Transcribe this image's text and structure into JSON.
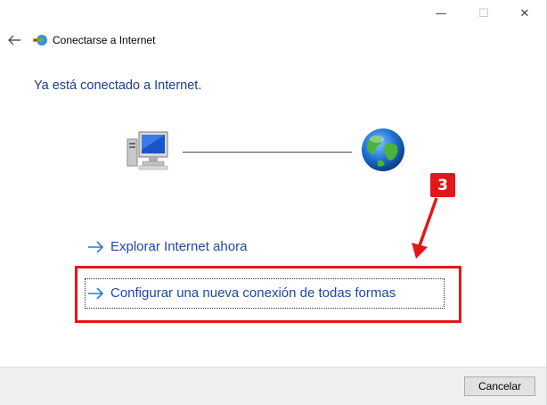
{
  "window": {
    "title": "Conectarse a Internet",
    "caption_buttons": {
      "minimize": "—",
      "maximize": "☐",
      "close": "✕"
    }
  },
  "main": {
    "heading": "Ya está conectado a Internet.",
    "links": [
      {
        "label": "Explorar Internet ahora"
      },
      {
        "label": "Configurar una nueva conexión de todas formas"
      }
    ]
  },
  "annotation": {
    "badge": "3",
    "color": "#e3161b"
  },
  "footer": {
    "cancel_label": "Cancelar"
  },
  "colors": {
    "link": "#1f47a4",
    "heading": "#1e3c8a",
    "arrow": "#2e7bd6"
  }
}
